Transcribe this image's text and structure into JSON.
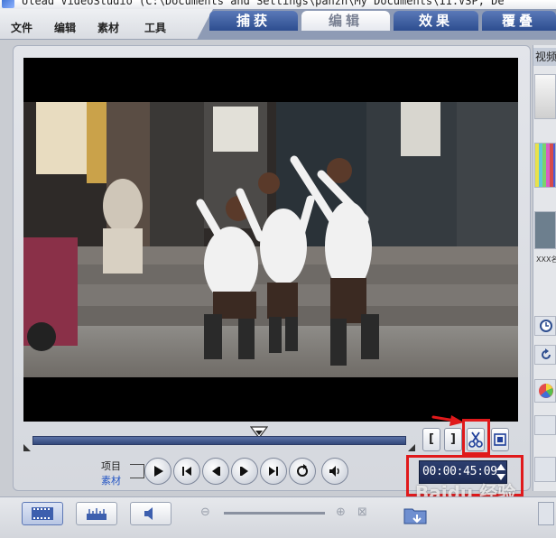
{
  "window": {
    "title": "Ulead VideoStudio (C:\\Documents and Settings\\panzh\\My Documents\\11.VSP, De"
  },
  "menu": {
    "items": [
      "文件",
      "编辑",
      "素材",
      "工具"
    ]
  },
  "tabs": [
    {
      "label": "捕获",
      "active": false
    },
    {
      "label": "编辑",
      "active": true
    },
    {
      "label": "效果",
      "active": false
    },
    {
      "label": "覆叠",
      "active": false
    }
  ],
  "player": {
    "mode_project": "项目",
    "mode_clip": "素材",
    "mark_in_label": "[",
    "mark_out_label": "]",
    "timecode": "00:00:45:09",
    "buttons": [
      "play",
      "go-to-start",
      "previous-frame",
      "next-frame",
      "go-to-end",
      "repeat",
      "volume"
    ]
  },
  "side_panel": {
    "tab_label": "视频",
    "thumb_caption": "XXX名"
  },
  "watermark": "Baidu 经验",
  "colors": {
    "highlight_red": "#e0191b",
    "tab_blue": "#2d4d8f",
    "timecode_bg": "#1c2a52"
  }
}
